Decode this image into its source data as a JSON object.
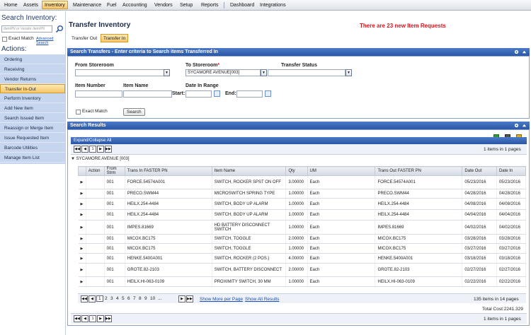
{
  "menu": {
    "items": [
      "Home",
      "Assets",
      "Inventory",
      "Maintenance",
      "Fuel",
      "Accounting",
      "Vendors",
      "Setup",
      "Reports",
      "Dashboard",
      "Integrations"
    ],
    "active": "Inventory"
  },
  "sidebar": {
    "search_title": "Search Inventory:",
    "search_placeholder": "ItemPN or Vendor ItemPN",
    "exact_match": "Exact Match",
    "advanced_search": "Advanced Search",
    "actions_title": "Actions:",
    "actions": [
      "Ordering",
      "Receiving",
      "Vendor Returns",
      "Transfer In-Out",
      "Perform Inventory",
      "Add New Item",
      "Search Issued Item",
      "Reassign or Merge Item",
      "Issue Requested Item",
      "Barcode Utilities",
      "Manage Item List"
    ],
    "active_action": "Transfer In-Out"
  },
  "page": {
    "title": "Transfer Inventory",
    "alert": "There are 23 new Item Requests",
    "tabs": [
      "Transfer Out",
      "Transfer In"
    ],
    "active_tab": "Transfer In"
  },
  "search_panel": {
    "header": "Search Transfers - Enter criteria to Search items Transferred In",
    "from_storeroom_label": "From Storeroom",
    "from_storeroom_value": "",
    "to_storeroom_label": "To Storeroom",
    "to_storeroom_required": "*",
    "to_storeroom_value": "SYCAMORE AVENUE[003]",
    "transfer_status_label": "Transfer Status",
    "transfer_status_value": "",
    "item_number_label": "Item Number",
    "item_name_label": "Item Name",
    "date_range_label": "Date In Range",
    "start_label": "Start:",
    "end_label": "End:",
    "exact_match": "Exact Match",
    "search_button": "Search"
  },
  "results_panel": {
    "header": "Search Results",
    "expand_collapse": "Expand/Collapse All",
    "top_pager_page": "1",
    "top_pager_info": "1 items in 1 pages",
    "group_label": "SYCAMORE AVENUE [003]",
    "columns": [
      "Action",
      "From Strm",
      "Trans In FASTER PN",
      "Item Name",
      "Qty",
      "UM",
      "Trans Out FASTER PN",
      "Date Out",
      "Date In"
    ],
    "rows": [
      [
        "",
        "001",
        "FORCE.54574A001",
        "SWITCH, ROCKER SPST ON OFF",
        "3.00000",
        "Each",
        "FORCE.54574A001",
        "05/23/2016",
        "05/23/2016"
      ],
      [
        "",
        "001",
        "PRECO.SWM44",
        "MICROSWITCH SPRING TYPE",
        "1.00000",
        "Each",
        "PRECO.SWM44",
        "04/28/2016",
        "04/28/2016"
      ],
      [
        "",
        "001",
        "HEILX.254-4484",
        "SWITCH, BODY UP ALARM",
        "1.00000",
        "Each",
        "HEILX.254-4484",
        "04/08/2016",
        "04/08/2016"
      ],
      [
        "",
        "001",
        "HEILX.254-4484",
        "SWITCH, BODY UP ALARM",
        "1.00000",
        "Each",
        "HEILX.254-4484",
        "04/04/2016",
        "04/04/2016"
      ],
      [
        "",
        "001",
        "IMPES.81669",
        "HD BATTERY DISCONNECT SWITCH",
        "1.00000",
        "Each",
        "IMPES.81669",
        "04/02/2016",
        "04/02/2016"
      ],
      [
        "",
        "001",
        "MICOX.BC175",
        "SWITCH, TOGGLE",
        "2.00000",
        "Each",
        "MICOX.BC175",
        "03/28/2016",
        "03/28/2016"
      ],
      [
        "",
        "001",
        "MICOX.BC175",
        "SWITCH, TOGGLE",
        "1.00000",
        "Each",
        "MICOX.BC175",
        "03/27/2016",
        "03/27/2016"
      ],
      [
        "",
        "001",
        "HENKE.5400A001",
        "SWITCH, ROCKER (2 POS.)",
        "4.00000",
        "Each",
        "HENKE.5400A001",
        "03/18/2016",
        "03/18/2016"
      ],
      [
        "",
        "001",
        "GROTE.82-2103",
        "SWITCH, BATTERY DISCONNECT",
        "2.00000",
        "Each",
        "GROTE.82-2103",
        "02/27/2016",
        "02/27/2016"
      ],
      [
        "",
        "001",
        "HEILX.HI-063-0109",
        "PROXIMITY SWITCH, 30 MM",
        "1.00000",
        "Each",
        "HEILX.HI-063-0109",
        "02/22/2016",
        "02/22/2016"
      ]
    ],
    "inner_pages": [
      "1",
      "2",
      "3",
      "4",
      "5",
      "6",
      "7",
      "8",
      "9",
      "10",
      "..."
    ],
    "show_more": "Show More per Page",
    "show_all": "Show All Results",
    "inner_info": "135 items in 14 pages",
    "total_cost": "Total Cost:2241.329",
    "bottom_pager_page": "1",
    "bottom_pager_info": "1 items in 1 pages"
  }
}
